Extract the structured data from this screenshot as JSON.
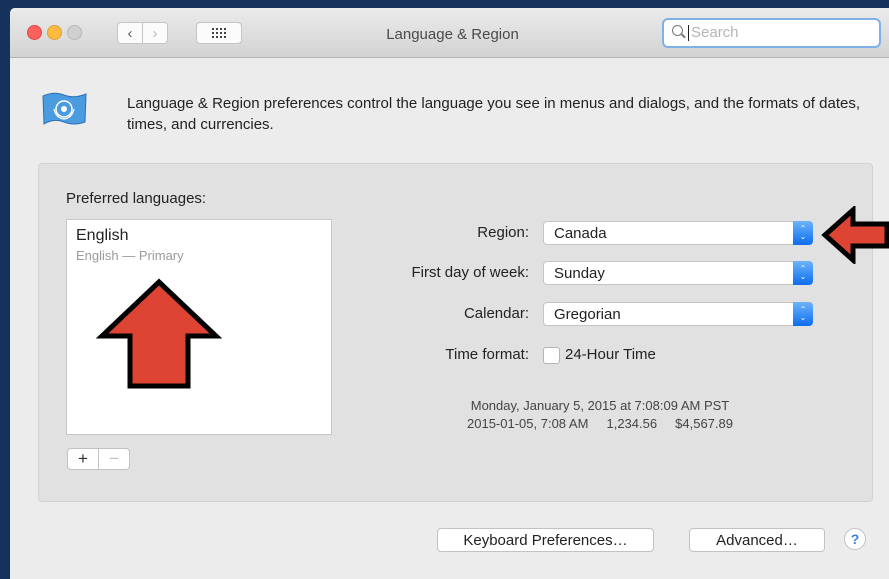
{
  "window": {
    "title": "Language & Region"
  },
  "toolbar": {
    "back_icon": "‹",
    "forward_icon": "›",
    "grid_icon": "show-all-grid"
  },
  "search": {
    "placeholder": "Search",
    "value": ""
  },
  "description": "Language & Region preferences control the language you see in menus and dialogs, and the formats of dates, times, and currencies.",
  "preferred_languages": {
    "label": "Preferred languages:",
    "items": [
      {
        "name": "English",
        "sub": "English — Primary"
      }
    ],
    "add_label": "+",
    "remove_label": "−"
  },
  "form": {
    "region": {
      "label": "Region:",
      "value": "Canada"
    },
    "first_day": {
      "label": "First day of week:",
      "value": "Sunday"
    },
    "calendar": {
      "label": "Calendar:",
      "value": "Gregorian"
    },
    "time_format": {
      "label": "Time format:",
      "checkbox_label": "24-Hour Time",
      "checked": false
    }
  },
  "example": {
    "line1": "Monday, January 5, 2015 at 7:08:09 AM PST",
    "line2": "2015-01-05, 7:08 AM     1,234.56     $4,567.89"
  },
  "buttons": {
    "keyboard": "Keyboard Preferences…",
    "advanced": "Advanced…",
    "help": "?"
  },
  "colors": {
    "annotation_arrow": "#dd4433",
    "accent": "#0c6df0",
    "desktop": "#14325c"
  },
  "stepper_glyphs": {
    "up": "⌃",
    "down": "⌄"
  }
}
